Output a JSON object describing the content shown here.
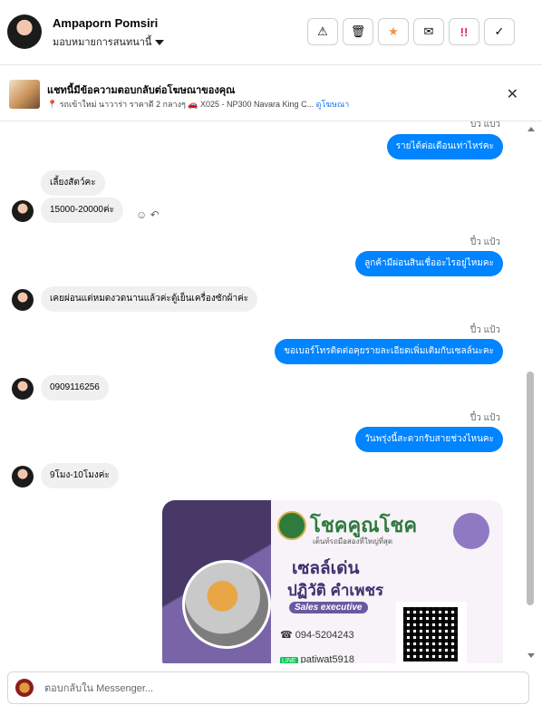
{
  "header": {
    "name": "Ampaporn Pomsiri",
    "subtitle": "มอบหมายการสนทนานี้"
  },
  "toolbar": {
    "spam_icon": "⚠",
    "trash_icon": "🗑",
    "star_icon": "★",
    "mail_icon": "✉",
    "flag_icon": "!!",
    "done_icon": "✓"
  },
  "ad_banner": {
    "title": "แชทนี้มีข้อความตอบกลับต่อโฆษณาของคุณ",
    "description": "📍 รถเข้าใหม่ นาวาร่า ราคาดี 2 กลางๆ 🚗 X025 - NP300 Navara King C...",
    "link": "ดูโฆษณา",
    "close": "✕"
  },
  "messages": [
    {
      "from": "agent",
      "text": "รายได้ต่อเดือนเท่าไหร่คะ",
      "seen": "ปี๋ว แป้ว"
    },
    {
      "from": "customer",
      "text": "เลี้ยงสัตว์คะ"
    },
    {
      "from": "customer",
      "text": "15000-20000ค่ะ"
    },
    {
      "from": "agent",
      "text": "ลูกค้ามีผ่อนสินเชื่ออะไรอยู่ไหมคะ",
      "seen": "ปี๋ว แป้ว"
    },
    {
      "from": "customer",
      "text": "เคยผ่อนแต่หมดงวดนานแล้วค่ะตู้เย็นเครื่องซักผ้าค่ะ"
    },
    {
      "from": "agent",
      "text": "ขอเบอร์โทรติดต่อคุยรายละเอียดเพิ่มเติมกับเซลล์นะคะ",
      "seen": "ปี๋ว แป้ว"
    },
    {
      "from": "customer",
      "text": "0909116256"
    },
    {
      "from": "agent",
      "text": "วันพรุ่งนี้สะดวกรับสายช่วงไหนคะ",
      "seen": "ปี๋ว แป้ว"
    },
    {
      "from": "customer",
      "text": "9โมง-10โมงค่ะ"
    }
  ],
  "card": {
    "brand": "โชคคูณโชค",
    "tagline": "เต็นท์รถมือสองที่ใหญ่ที่สุด",
    "role": "เซลล์เด่น",
    "name": "ปฏิวัติ  คำเพชร",
    "position": "Sales executive",
    "phone": "094-5204243",
    "line": "patiwat5918"
  },
  "composer": {
    "placeholder": "ตอบกลับใน Messenger..."
  },
  "colors": {
    "accent": "#0084ff",
    "incoming_bg": "#f0f0f0",
    "card_purple": "#473868"
  }
}
